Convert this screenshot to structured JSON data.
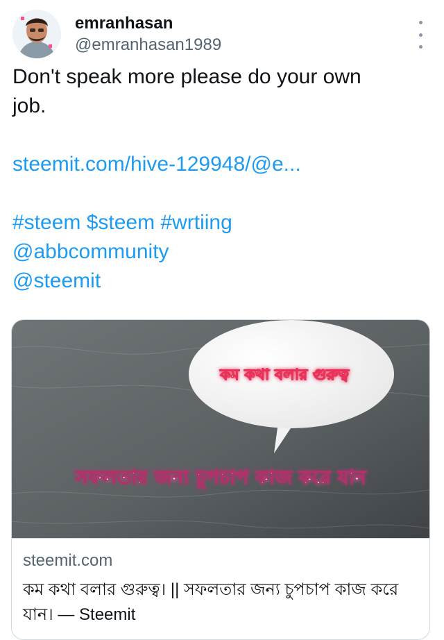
{
  "author": {
    "display_name": "emranhasan",
    "handle": "@emranhasan1989"
  },
  "menu_icon": "more-vertical-icon",
  "tweet": {
    "text_line1": "Don't speak more please do your own",
    "text_line2": "job.",
    "link_text": "steemit.com/hive-129948/@e...",
    "tags_line": "#steem $steem #wrtiing",
    "mention1": "@abbcommunity",
    "mention2": "@steemit"
  },
  "card": {
    "bubble_text": "কম কথা বলার গুরুত্ব",
    "banner_text": "সফলতার জন্য চুপচাপ কাজ করে যান",
    "domain": "steemit.com",
    "title": "কম কথা বলার গুরুত্ব। || সফলতার জন্য চুপচাপ কাজ করে যান। — Steemit"
  },
  "colors": {
    "link": "#1d9bf0",
    "text": "#0f1419",
    "secondary": "#536471",
    "border": "#cfd9de"
  }
}
